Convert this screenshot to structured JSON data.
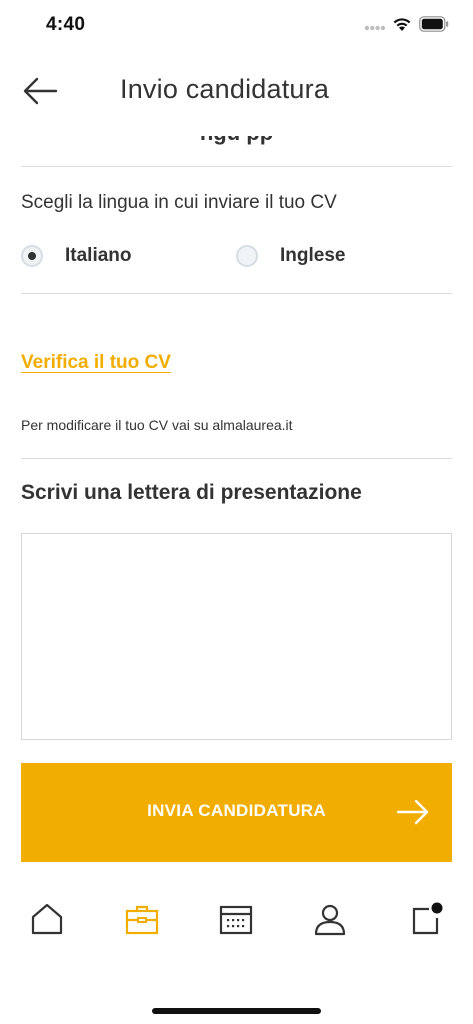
{
  "status_bar": {
    "time": "4:40"
  },
  "header": {
    "title": "Invio candidatura",
    "back_icon": "arrow-left-icon"
  },
  "scrolled_partial_text": "ngu pp",
  "language": {
    "label": "Scegli la lingua in cui inviare il tuo CV",
    "options": [
      {
        "label": "Italiano",
        "selected": true
      },
      {
        "label": "Inglese",
        "selected": false
      }
    ]
  },
  "cv": {
    "verify_link": "Verifica il tuo CV",
    "info": "Per modificare il tuo CV vai su almalaurea.it"
  },
  "letter": {
    "heading": "Scrivi una lettera di presentazione",
    "value": ""
  },
  "submit": {
    "label": "INVIA CANDIDATURA",
    "icon": "arrow-right-icon"
  },
  "tab_bar": {
    "items": [
      {
        "icon": "home-icon",
        "active": false
      },
      {
        "icon": "briefcase-icon",
        "active": true
      },
      {
        "icon": "calendar-icon",
        "active": false
      },
      {
        "icon": "user-icon",
        "active": false
      },
      {
        "icon": "notification-icon",
        "active": false
      }
    ]
  },
  "colors": {
    "accent": "#f2ae00",
    "text": "#333333",
    "divider": "#dcdcdc"
  }
}
